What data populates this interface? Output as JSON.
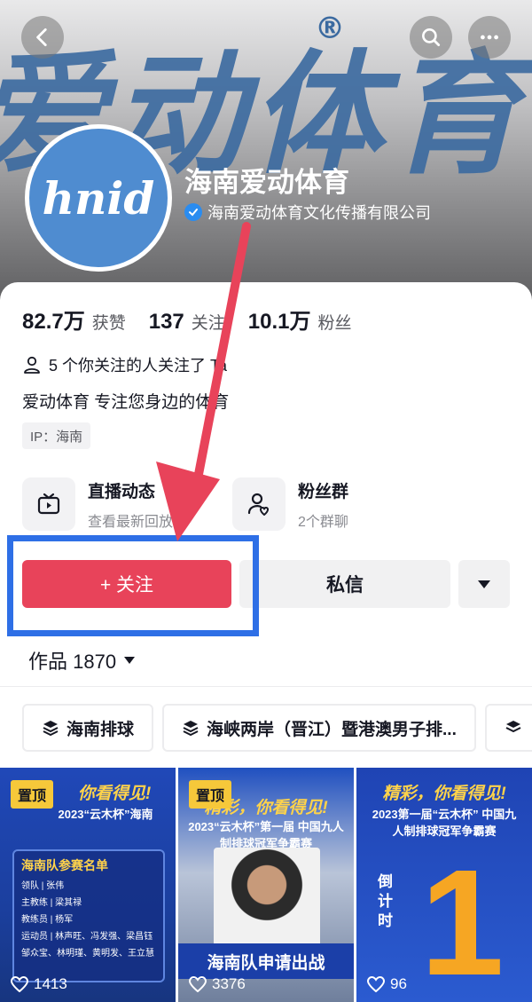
{
  "header": {
    "banner_text": "爱动体育",
    "banner_reg": "®",
    "back_icon": "back-icon",
    "search_icon": "search-icon",
    "more_icon": "more-icon"
  },
  "profile": {
    "avatar_text": "hnid",
    "name": "海南爱动体育",
    "verified_org": "海南爱动体育文化传播有限公司"
  },
  "stats": [
    {
      "num": "82.7万",
      "label": "获赞"
    },
    {
      "num": "137",
      "label": "关注"
    },
    {
      "num": "10.1万",
      "label": "粉丝"
    }
  ],
  "mutual_text": "5 个你关注的人关注了 Ta",
  "bio": "爱动体育 专注您身边的体育",
  "ip": "IP：海南",
  "features": [
    {
      "title": "直播动态",
      "sub": "查看最新回放",
      "icon": "tv-icon"
    },
    {
      "title": "粉丝群",
      "sub": "2个群聊",
      "icon": "fan-group-icon"
    }
  ],
  "actions": {
    "follow": "+ 关注",
    "message": "私信"
  },
  "works": {
    "label": "作品 1870"
  },
  "chips": [
    {
      "label": "海南排球"
    },
    {
      "label": "海峡两岸（晋江）暨港澳男子排..."
    }
  ],
  "videos": [
    {
      "pinned": "置顶",
      "title": "你看得见!",
      "sub": "2023“云木杯”海南",
      "likes": "1413",
      "roster_title": "海南队参赛名单",
      "roster_lines": [
        "领队 | 张伟",
        "主教练 | 梁其禄",
        "教练员 | 杨军",
        "运动员 | 林声旺、冯发强、梁昌钰",
        "邹众宝、林明瑾、黄明发、王立慧"
      ]
    },
    {
      "pinned": "置顶",
      "title": "精彩，你看得见!",
      "sub": "2023“云木杯”第一届 中国九人制排球冠军争霸赛",
      "likes": "3376",
      "banner": "海南队申请出战"
    },
    {
      "pinned": "",
      "title": "精彩，你看得见!",
      "sub": "2023第一届“云木杯” 中国九人制排球冠军争霸赛",
      "likes": "96",
      "countdown": "倒计时",
      "big": "1"
    }
  ],
  "colors": {
    "follow": "#e8435a",
    "highlight": "#2e6fe6",
    "arrow": "#e8435a"
  }
}
